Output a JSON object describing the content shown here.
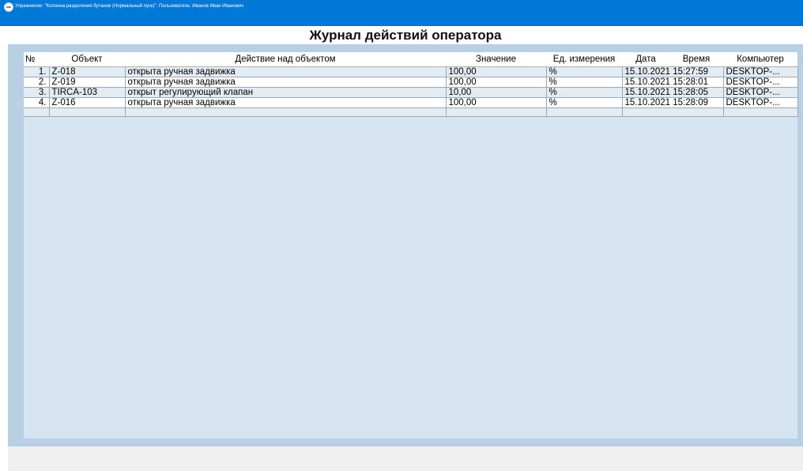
{
  "window": {
    "title": "Упражнение: \"Колонна разделения бутанов (Нормальный пуск)\".  Пользователь: Иванов Иван Иванович"
  },
  "page_title": "Журнал действий оператора",
  "table": {
    "headers": {
      "num": "№",
      "object": "Объект",
      "action": "Действие над объектом",
      "value": "Значение",
      "unit": "Ед. измерения",
      "date": "Дата",
      "time": "Время",
      "computer": "Компьютер"
    },
    "rows": [
      {
        "num": "1.",
        "object": "Z-018",
        "action": "открыта ручная задвижка",
        "value": "100,00",
        "unit": "%",
        "datetime": "15.10.2021 15:27:59",
        "computer": "DESKTOP-..."
      },
      {
        "num": "2.",
        "object": "Z-019",
        "action": "открыта ручная задвижка",
        "value": "100,00",
        "unit": "%",
        "datetime": "15.10.2021 15:28:01",
        "computer": "DESKTOP-..."
      },
      {
        "num": "3.",
        "object": "TIRCA-103",
        "action": "открыт регулирующий клапан",
        "value": "10,00",
        "unit": "%",
        "datetime": "15.10.2021 15:28:05",
        "computer": "DESKTOP-..."
      },
      {
        "num": "4.",
        "object": "Z-016",
        "action": "открыта ручная задвижка",
        "value": "100,00",
        "unit": "%",
        "datetime": "15.10.2021 15:28:09",
        "computer": "DESKTOP-..."
      }
    ]
  }
}
